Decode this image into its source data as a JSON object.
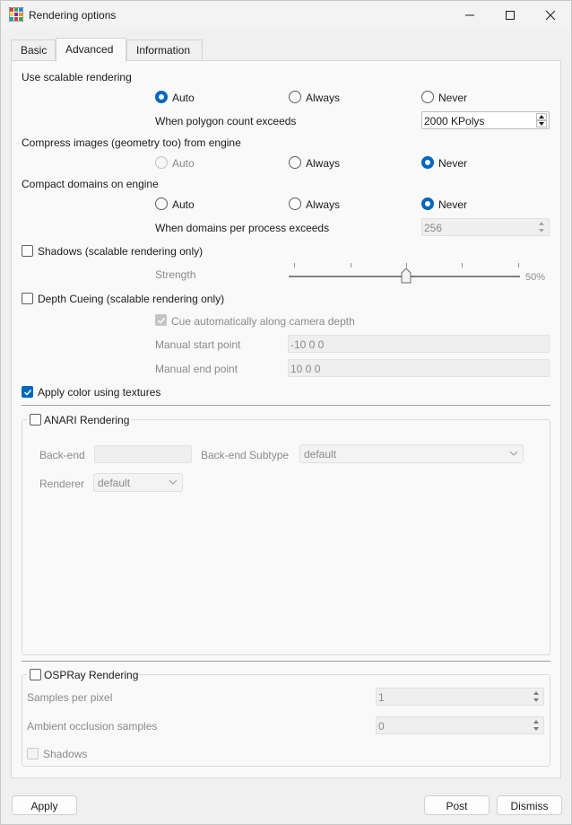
{
  "window": {
    "title": "Rendering options"
  },
  "tabs": [
    {
      "label": "Basic"
    },
    {
      "label": "Advanced"
    },
    {
      "label": "Information"
    }
  ],
  "active_tab": "Advanced",
  "scalable": {
    "heading": "Use scalable rendering",
    "options": [
      "Auto",
      "Always",
      "Never"
    ],
    "selected": "Auto",
    "threshold_label": "When polygon count exceeds",
    "threshold_value": "2000 KPolys"
  },
  "compress": {
    "heading": "Compress images (geometry too) from engine",
    "options": [
      "Auto",
      "Always",
      "Never"
    ],
    "selected": "Never"
  },
  "compact": {
    "heading": "Compact domains on engine",
    "options": [
      "Auto",
      "Always",
      "Never"
    ],
    "selected": "Never",
    "threshold_label": "When domains per process exceeds",
    "threshold_value": "256"
  },
  "shadows": {
    "label": "Shadows (scalable rendering only)",
    "checked": false,
    "strength_label": "Strength",
    "strength_value": 0.5,
    "strength_text": "50%"
  },
  "depth_cueing": {
    "label": "Depth Cueing (scalable rendering only)",
    "checked": false,
    "auto_label": "Cue automatically along camera depth",
    "auto_checked": true,
    "start_label": "Manual start point",
    "start_value": "-10 0 0",
    "end_label": "Manual end point",
    "end_value": "10 0 0"
  },
  "textures": {
    "label": "Apply color using textures",
    "checked": true
  },
  "anari": {
    "label": "ANARI Rendering",
    "checked": false,
    "backend_label": "Back-end",
    "backend_value": "",
    "subtype_label": "Back-end Subtype",
    "subtype_value": "default",
    "renderer_label": "Renderer",
    "renderer_value": "default"
  },
  "ospray": {
    "label": "OSPRay Rendering",
    "checked": false,
    "spp_label": "Samples per pixel",
    "spp_value": "1",
    "ao_label": "Ambient occlusion samples",
    "ao_value": "0",
    "shadows_label": "Shadows",
    "shadows_checked": false
  },
  "buttons": {
    "apply": "Apply",
    "post": "Post",
    "dismiss": "Dismiss"
  },
  "colors": {
    "accent": "#0067c0",
    "panel": "#f9f9f9",
    "window": "#f0f0f0"
  }
}
